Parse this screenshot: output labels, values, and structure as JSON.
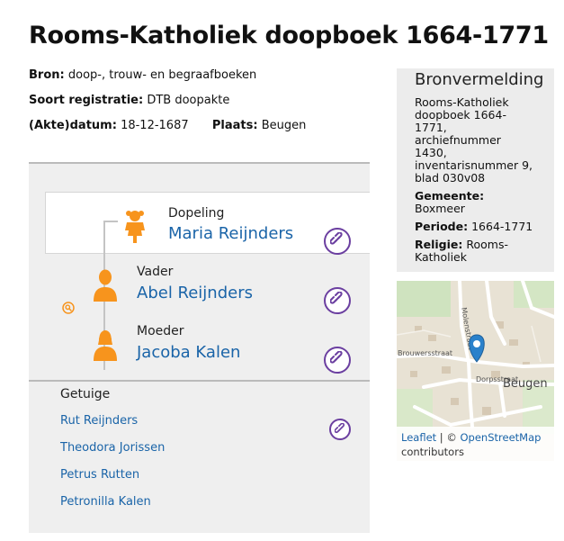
{
  "header": {
    "title": "Rooms-Katholiek doopboek 1664-1771"
  },
  "meta": {
    "bron_label": "Bron:",
    "bron_value": "doop-, trouw- en begraafboeken",
    "soort_label": "Soort registratie:",
    "soort_value": "DTB doopakte",
    "datum_label": "(Akte)datum:",
    "datum_value": "18-12-1687",
    "plaats_label": "Plaats:",
    "plaats_value": "Beugen"
  },
  "persons": {
    "child": {
      "role": "Dopeling",
      "name": "Maria Reijnders"
    },
    "father": {
      "role": "Vader",
      "name": "Abel Reijnders"
    },
    "mother": {
      "role": "Moeder",
      "name": "Jacoba Kalen"
    }
  },
  "witnesses": {
    "label": "Getuige",
    "items": [
      "Rut Reijnders",
      "Theodora Jorissen",
      "Petrus Rutten",
      "Petronilla Kalen"
    ]
  },
  "citation": {
    "title": "Bronvermelding",
    "text": "Rooms-Katholiek doopboek 1664-1771, archiefnummer 1430, inventarisnummer 9, blad 030v08",
    "gemeente_label": "Gemeente",
    "gemeente_value": "Boxmeer",
    "periode_label": "Periode",
    "periode_value": "1664-1771",
    "religie_label": "Religie",
    "religie_value": "Rooms-Katholiek"
  },
  "map": {
    "streets": [
      "Brouwersstraat",
      "Dorpsstraat",
      "Molenstraat",
      "Beugen"
    ],
    "attribution_leaflet": "Leaflet",
    "attribution_sep": " | © ",
    "attribution_osm": "OpenStreetMap",
    "attribution_rest": "contributors"
  },
  "colors": {
    "accent_orange": "#f7941d",
    "link_blue": "#1a64a8",
    "link_purple": "#6b3fa0",
    "map_marker": "#2a81cb"
  },
  "icons": {
    "child": "child-person-icon",
    "father": "man-person-icon",
    "mother": "woman-person-icon",
    "relation": "chain-link-icon",
    "search": "magnifier-icon",
    "marker": "map-marker-icon"
  }
}
